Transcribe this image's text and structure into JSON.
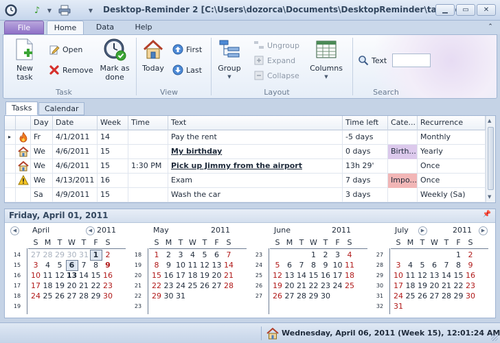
{
  "window": {
    "title": "Desktop-Reminder 2 [C:\\Users\\dozorca\\Documents\\DesktopReminder\\tasks.dr2]",
    "quick_access": [
      "clock-icon",
      "music-note-icon",
      "dropdown-arrow-icon",
      "printer-icon",
      "customize-arrow-icon"
    ],
    "controls": [
      "minimize",
      "maximize",
      "close"
    ]
  },
  "ribbon_tabs": [
    "File",
    "Home",
    "Data",
    "Help"
  ],
  "ribbon": {
    "task_group": {
      "label": "Task",
      "new_task": "New task",
      "open": "Open",
      "remove": "Remove",
      "mark_done": "Mark as done"
    },
    "view_group": {
      "label": "View",
      "today": "Today",
      "first": "First",
      "last": "Last"
    },
    "layout_group": {
      "label": "Layout",
      "group": "Group",
      "ungroup": "Ungroup",
      "expand": "Expand",
      "collapse": "Collapse",
      "columns": "Columns"
    },
    "search_group": {
      "label": "Search",
      "text": "Text",
      "text_value": ""
    }
  },
  "view_tabs": [
    "Tasks",
    "Calendar"
  ],
  "grid": {
    "columns": [
      "",
      "Day",
      "Date",
      "Week",
      "Time",
      "Text",
      "Time left",
      "Cate...",
      "Recurrence"
    ],
    "rows": [
      {
        "indicator": "▸",
        "icon": "fire-icon",
        "day": "Fr",
        "date": "4/1/2011",
        "week": "14",
        "time": "",
        "text": "Pay the rent",
        "time_left": "-5 days",
        "category": "",
        "recurrence": "Monthly"
      },
      {
        "indicator": "",
        "icon": "house-icon",
        "day": "We",
        "date": "4/6/2011",
        "week": "15",
        "time": "",
        "text": "My birthday",
        "time_left": "0 days",
        "category": "Birth...",
        "recurrence": "Yearly"
      },
      {
        "indicator": "",
        "icon": "house-icon",
        "day": "We",
        "date": "4/6/2011",
        "week": "15",
        "time": "1:30 PM",
        "text": "Pick up Jimmy from the airport",
        "time_left": "13h 29'",
        "category": "",
        "recurrence": "Once"
      },
      {
        "indicator": "",
        "icon": "warning-icon",
        "day": "We",
        "date": "4/13/2011",
        "week": "16",
        "time": "",
        "text": "Exam",
        "time_left": "7 days",
        "category": "Impo...",
        "recurrence": "Once"
      },
      {
        "indicator": "",
        "icon": "",
        "day": "Sa",
        "date": "4/9/2011",
        "week": "15",
        "time": "",
        "text": "Wash the car",
        "time_left": "3 days",
        "category": "",
        "recurrence": "Weekly (Sa)"
      }
    ]
  },
  "calendar": {
    "header": "Friday, April 01, 2011",
    "dow": [
      "S",
      "M",
      "T",
      "W",
      "T",
      "F",
      "S"
    ],
    "months": [
      {
        "name": "April",
        "year": "2011",
        "weeks": [
          "14",
          "15",
          "16",
          "17",
          "18",
          "19"
        ],
        "days": [
          [
            "27",
            "28",
            "29",
            "30",
            "31",
            "1",
            "2"
          ],
          [
            "3",
            "4",
            "5",
            "6",
            "7",
            "8",
            "9"
          ],
          [
            "10",
            "11",
            "12",
            "13",
            "14",
            "15",
            "16"
          ],
          [
            "17",
            "18",
            "19",
            "20",
            "21",
            "22",
            "23"
          ],
          [
            "24",
            "25",
            "26",
            "27",
            "28",
            "29",
            "30"
          ],
          [
            "",
            "",
            "",
            "",
            "",
            "",
            ""
          ]
        ]
      },
      {
        "name": "May",
        "year": "2011",
        "weeks": [
          "18",
          "19",
          "20",
          "21",
          "22",
          "23"
        ],
        "days": [
          [
            "1",
            "2",
            "3",
            "4",
            "5",
            "6",
            "7"
          ],
          [
            "8",
            "9",
            "10",
            "11",
            "12",
            "13",
            "14"
          ],
          [
            "15",
            "16",
            "17",
            "18",
            "19",
            "20",
            "21"
          ],
          [
            "22",
            "23",
            "24",
            "25",
            "26",
            "27",
            "28"
          ],
          [
            "29",
            "30",
            "31",
            "",
            "",
            "",
            ""
          ],
          [
            "",
            "",
            "",
            "",
            "",
            "",
            ""
          ]
        ]
      },
      {
        "name": "June",
        "year": "2011",
        "weeks": [
          "23",
          "24",
          "25",
          "26",
          "27"
        ],
        "days": [
          [
            "",
            "",
            "",
            "1",
            "2",
            "3",
            "4"
          ],
          [
            "5",
            "6",
            "7",
            "8",
            "9",
            "10",
            "11"
          ],
          [
            "12",
            "13",
            "14",
            "15",
            "16",
            "17",
            "18"
          ],
          [
            "19",
            "20",
            "21",
            "22",
            "23",
            "24",
            "25"
          ],
          [
            "26",
            "27",
            "28",
            "29",
            "30",
            "",
            ""
          ]
        ]
      },
      {
        "name": "July",
        "year": "2011",
        "weeks": [
          "27",
          "28",
          "29",
          "30",
          "31",
          "32"
        ],
        "days": [
          [
            "",
            "",
            "",
            "",
            "",
            "1",
            "2"
          ],
          [
            "3",
            "4",
            "5",
            "6",
            "7",
            "8",
            "9"
          ],
          [
            "10",
            "11",
            "12",
            "13",
            "14",
            "15",
            "16"
          ],
          [
            "17",
            "18",
            "19",
            "20",
            "21",
            "22",
            "23"
          ],
          [
            "24",
            "25",
            "26",
            "27",
            "28",
            "29",
            "30"
          ],
          [
            "31",
            "",
            "",
            "",
            "",
            "",
            ""
          ]
        ]
      }
    ]
  },
  "status": {
    "text": "Wednesday, April 06, 2011 (Week 15), 12:01:24 AM"
  }
}
